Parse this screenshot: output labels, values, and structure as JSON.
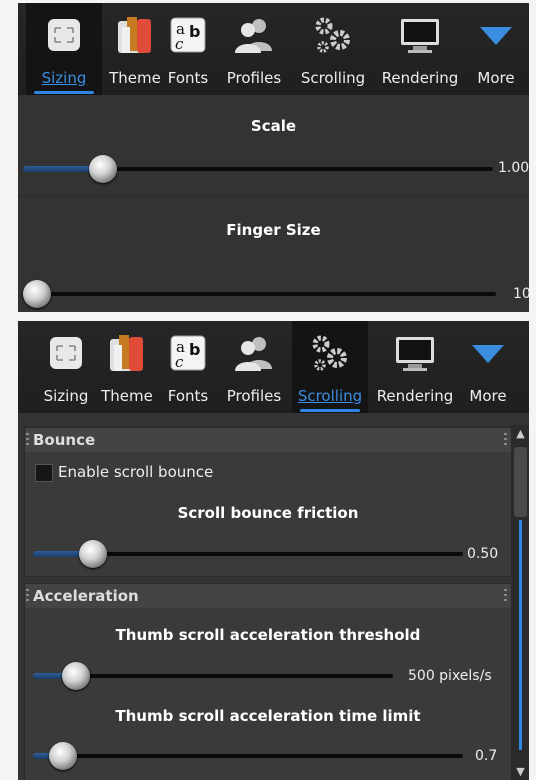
{
  "toolbar_items": [
    {
      "label": "Sizing",
      "icon": "sizing-icon"
    },
    {
      "label": "Theme",
      "icon": "theme-icon"
    },
    {
      "label": "Fonts",
      "icon": "fonts-icon"
    },
    {
      "label": "Profiles",
      "icon": "profiles-icon"
    },
    {
      "label": "Scrolling",
      "icon": "scrolling-icon"
    },
    {
      "label": "Rendering",
      "icon": "rendering-icon"
    },
    {
      "label": "More",
      "icon": "more-icon"
    }
  ],
  "top_panel": {
    "active_tab": "Sizing",
    "scale": {
      "title": "Scale",
      "value_text": "1.00",
      "position_fraction": 0.17
    },
    "finger_size": {
      "title": "Finger Size",
      "value_text": "10",
      "position_fraction": 0.03
    }
  },
  "bottom_panel": {
    "active_tab": "Scrolling",
    "bounce": {
      "header": "Bounce",
      "enable_label": "Enable scroll bounce",
      "enabled": false,
      "friction": {
        "title": "Scroll bounce friction",
        "value_text": "0.50",
        "position_fraction": 0.14
      }
    },
    "acceleration": {
      "header": "Acceleration",
      "threshold": {
        "title": "Thumb scroll acceleration threshold",
        "value_text": "500 pixels/s",
        "position_fraction": 0.12
      },
      "time_limit": {
        "title": "Thumb scroll acceleration time limit",
        "value_text": "0.7",
        "position_fraction": 0.07
      }
    }
  },
  "colors": {
    "accent": "#2f86e6",
    "panel": "#333333",
    "toolbar": "#242424"
  }
}
